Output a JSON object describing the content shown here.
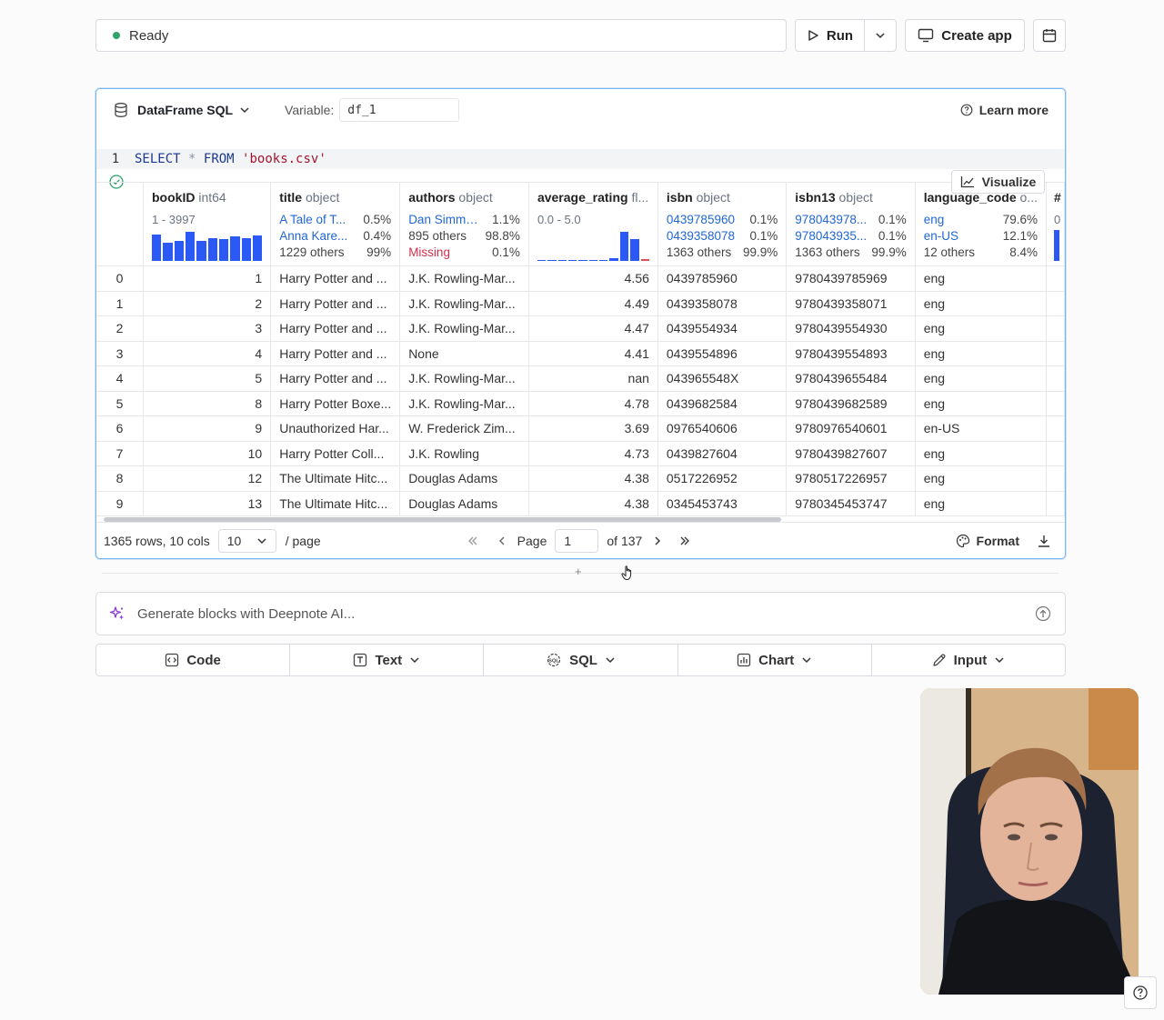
{
  "toolbar": {
    "status": "Ready",
    "run_label": "Run",
    "create_app_label": "Create app"
  },
  "cell": {
    "block_type": "DataFrame SQL",
    "variable_label": "Variable:",
    "variable_value": "df_1",
    "learn_more": "Learn more",
    "line_number": "1",
    "code": {
      "kw1": "SELECT",
      "star": "*",
      "kw2": "FROM",
      "str": "'books.csv'"
    },
    "visualize_label": "Visualize"
  },
  "table": {
    "columns": [
      {
        "name": "bookID",
        "type": "int64",
        "range": "1 - 3997",
        "hist": [
          0.85,
          0.6,
          0.65,
          0.95,
          0.65,
          0.75,
          0.7,
          0.8,
          0.75,
          0.82
        ]
      },
      {
        "name": "title",
        "type": "object",
        "top": [
          {
            "v": "A Tale of T...",
            "p": "0.5%"
          },
          {
            "v": "Anna Kare...",
            "p": "0.4%"
          }
        ],
        "others": {
          "v": "1229 others",
          "p": "99%"
        }
      },
      {
        "name": "authors",
        "type": "object",
        "top": [
          {
            "v": "Dan Simmo...",
            "p": "1.1%"
          }
        ],
        "others": {
          "v": "895 others",
          "p": "98.8%"
        },
        "missing": {
          "v": "Missing",
          "p": "0.1%"
        }
      },
      {
        "name": "average_rating",
        "type": "fl...",
        "range": "0.0 - 5.0",
        "hist": [
          0.03,
          0.03,
          0.03,
          0.03,
          0.03,
          0.03,
          0.03,
          0.1,
          0.95,
          0.7,
          0.05
        ]
      },
      {
        "name": "isbn",
        "type": "object",
        "top": [
          {
            "v": "0439785960",
            "p": "0.1%"
          },
          {
            "v": "0439358078",
            "p": "0.1%"
          }
        ],
        "others": {
          "v": "1363 others",
          "p": "99.9%"
        }
      },
      {
        "name": "isbn13",
        "type": "object",
        "top": [
          {
            "v": "978043978...",
            "p": "0.1%"
          },
          {
            "v": "978043935...",
            "p": "0.1%"
          }
        ],
        "others": {
          "v": "1363 others",
          "p": "99.9%"
        }
      },
      {
        "name": "language_code",
        "type": "o...",
        "top": [
          {
            "v": "eng",
            "p": "79.6%"
          },
          {
            "v": "en-US",
            "p": "12.1%"
          }
        ],
        "others": {
          "v": "12 others",
          "p": "8.4%"
        }
      },
      {
        "name": "#",
        "partial_range": "0"
      }
    ],
    "rows": [
      [
        "0",
        "1",
        "Harry Potter and ...",
        "J.K. Rowling-Mar...",
        "4.56",
        "0439785960",
        "9780439785969",
        "eng"
      ],
      [
        "1",
        "2",
        "Harry Potter and ...",
        "J.K. Rowling-Mar...",
        "4.49",
        "0439358078",
        "9780439358071",
        "eng"
      ],
      [
        "2",
        "3",
        "Harry Potter and ...",
        "J.K. Rowling-Mar...",
        "4.47",
        "0439554934",
        "9780439554930",
        "eng"
      ],
      [
        "3",
        "4",
        "Harry Potter and ...",
        "None",
        "4.41",
        "0439554896",
        "9780439554893",
        "eng"
      ],
      [
        "4",
        "5",
        "Harry Potter and ...",
        "J.K. Rowling-Mar...",
        "nan",
        "043965548X",
        "9780439655484",
        "eng"
      ],
      [
        "5",
        "8",
        "Harry Potter Boxe...",
        "J.K. Rowling-Mar...",
        "4.78",
        "0439682584",
        "9780439682589",
        "eng"
      ],
      [
        "6",
        "9",
        "Unauthorized Har...",
        "W. Frederick Zim...",
        "3.69",
        "0976540606",
        "9780976540601",
        "en-US"
      ],
      [
        "7",
        "10",
        "Harry Potter Coll...",
        "J.K. Rowling",
        "4.73",
        "0439827604",
        "9780439827607",
        "eng"
      ],
      [
        "8",
        "12",
        "The Ultimate Hitc...",
        "Douglas Adams",
        "4.38",
        "0517226952",
        "9780517226957",
        "eng"
      ],
      [
        "9",
        "13",
        "The Ultimate Hitc...",
        "Douglas Adams",
        "4.38",
        "0345453743",
        "9780345453747",
        "eng"
      ]
    ]
  },
  "footer": {
    "summary": "1365 rows, 10 cols",
    "page_size": "10",
    "per_page": "/ page",
    "page_label": "Page",
    "page_value": "1",
    "of_label": "of 137",
    "format_label": "Format"
  },
  "add_block": {
    "plus": "+"
  },
  "ai": {
    "placeholder": "Generate blocks with Deepnote AI..."
  },
  "blocks": {
    "code": "Code",
    "text": "Text",
    "sql": "SQL",
    "chart": "Chart",
    "input": "Input"
  },
  "colors": {
    "accent": "#2b59f5",
    "link": "#2167d3",
    "missing": "#d32f4a",
    "status_ok": "#2fa36b"
  }
}
